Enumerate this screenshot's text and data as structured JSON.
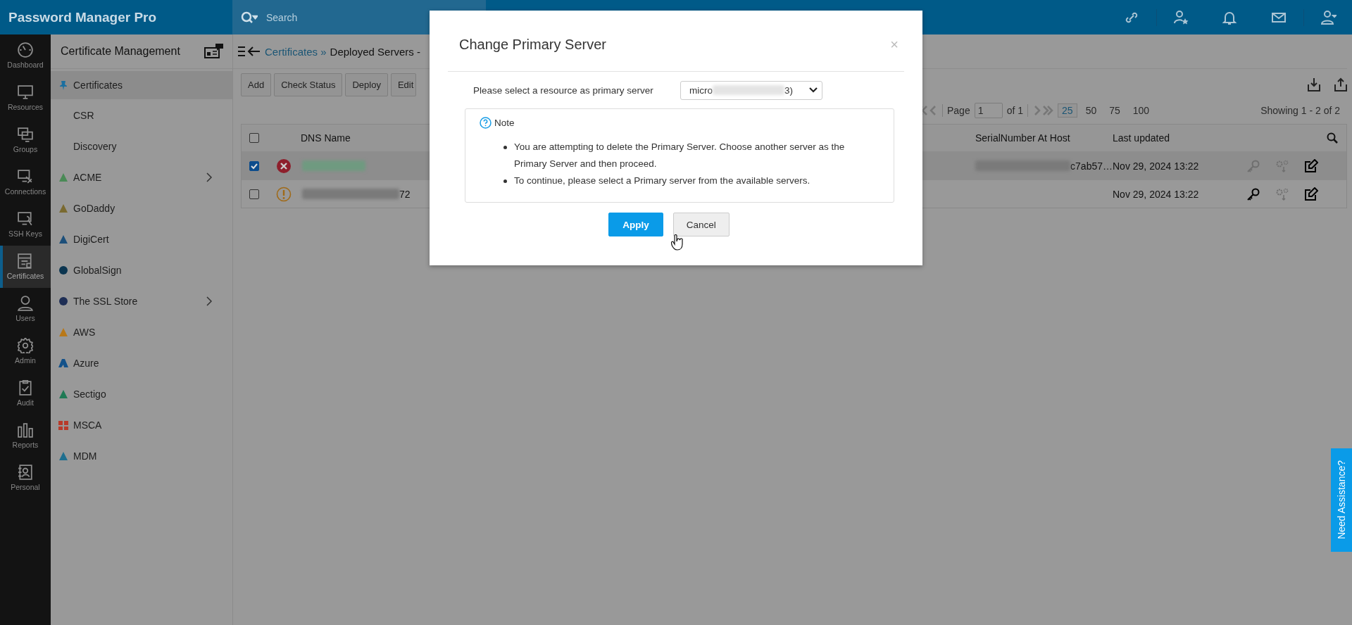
{
  "app": {
    "logo": "Password Manager Pro",
    "search_placeholder": "Search"
  },
  "nav": [
    {
      "label": "Dashboard",
      "selected": false
    },
    {
      "label": "Resources",
      "selected": false
    },
    {
      "label": "Groups",
      "selected": false
    },
    {
      "label": "Connections",
      "selected": false
    },
    {
      "label": "SSH Keys",
      "selected": false
    },
    {
      "label": "Certificates",
      "selected": true
    },
    {
      "label": "Users",
      "selected": false
    },
    {
      "label": "Admin",
      "selected": false
    },
    {
      "label": "Audit",
      "selected": false
    },
    {
      "label": "Reports",
      "selected": false
    },
    {
      "label": "Personal",
      "selected": false
    }
  ],
  "sidebar": {
    "title": "Certificate Management",
    "items": [
      {
        "label": "Certificates",
        "selected": true,
        "expandable": false
      },
      {
        "label": "CSR",
        "selected": false,
        "expandable": false
      },
      {
        "label": "Discovery",
        "selected": false,
        "expandable": false
      },
      {
        "label": "ACME",
        "selected": false,
        "expandable": true
      },
      {
        "label": "GoDaddy",
        "selected": false,
        "expandable": false
      },
      {
        "label": "DigiCert",
        "selected": false,
        "expandable": false
      },
      {
        "label": "GlobalSign",
        "selected": false,
        "expandable": false
      },
      {
        "label": "The SSL Store",
        "selected": false,
        "expandable": true
      },
      {
        "label": "AWS",
        "selected": false,
        "expandable": false
      },
      {
        "label": "Azure",
        "selected": false,
        "expandable": false
      },
      {
        "label": "Sectigo",
        "selected": false,
        "expandable": false
      },
      {
        "label": "MSCA",
        "selected": false,
        "expandable": false
      },
      {
        "label": "MDM",
        "selected": false,
        "expandable": false
      }
    ]
  },
  "breadcrumb": {
    "link": "Certificates »",
    "current": "Deployed Servers -"
  },
  "toolbar": [
    "Add",
    "Check Status",
    "Deploy",
    "Edit"
  ],
  "pagination": {
    "page_label": "Page",
    "page": "1",
    "of": "of 1",
    "sizes": [
      {
        "label": "25",
        "selected": true
      },
      {
        "label": "50",
        "selected": false
      },
      {
        "label": "75",
        "selected": false
      },
      {
        "label": "100",
        "selected": false
      }
    ],
    "showing": "Showing 1 - 2 of 2"
  },
  "table": {
    "columns": [
      "DNS Name",
      "SerialNumber At Host",
      "Last updated"
    ],
    "select_all_checked": false,
    "rows": [
      {
        "checked": true,
        "selected": true,
        "kind": "error",
        "link": true,
        "serial_tail": "c7ab57…",
        "last_updated": "Nov 29, 2024 13:22",
        "key_enabled": false
      },
      {
        "checked": false,
        "selected": false,
        "kind": "warning",
        "link": false,
        "dns_tail": "72",
        "last_updated": "Nov 29, 2024 13:22",
        "key_enabled": true
      }
    ]
  },
  "dialog": {
    "title": "Change Primary Server",
    "close": "×",
    "label": "Please select a resource as primary server",
    "select_start": "micro",
    "select_end": "3)",
    "note_title": "Note",
    "notes": [
      "You are attempting to delete the Primary Server. Choose another server as the Primary Server and then proceed.",
      "To continue, please select a Primary server from the available servers."
    ],
    "buttons": [
      {
        "label": "Apply",
        "kind": "primary"
      },
      {
        "label": "Cancel",
        "kind": "secondary"
      }
    ]
  },
  "help_tab": "Need Assistance?"
}
